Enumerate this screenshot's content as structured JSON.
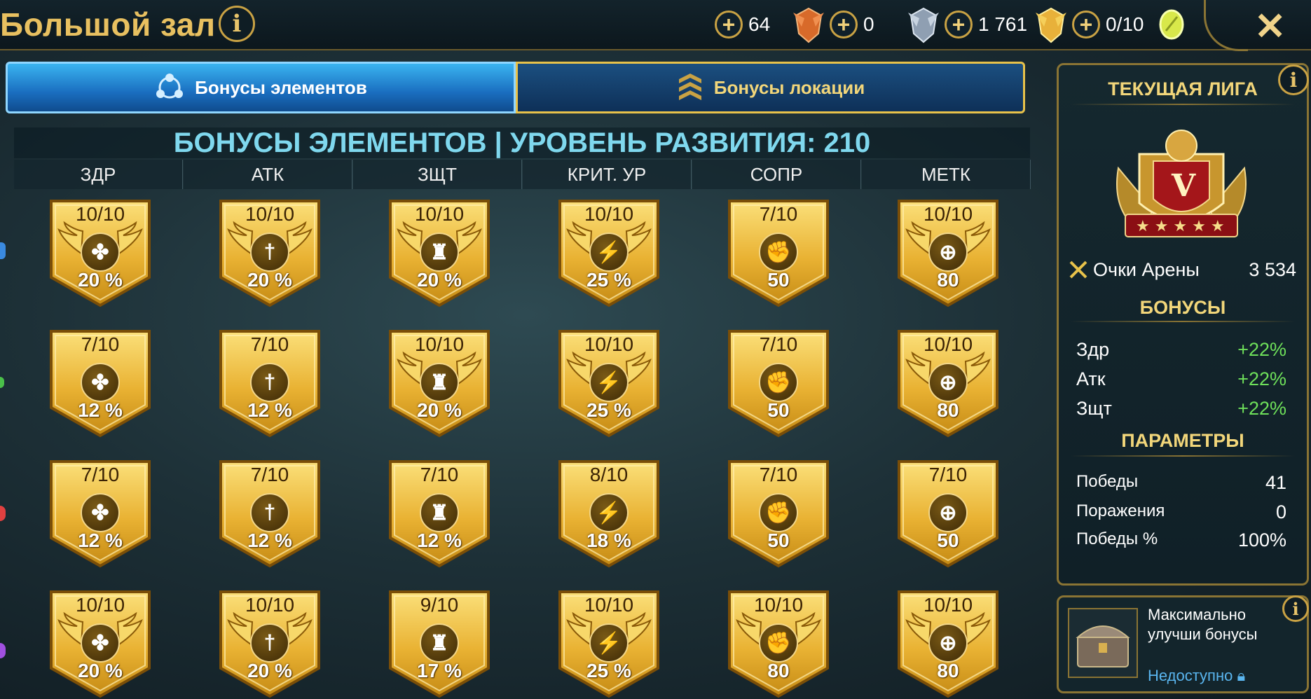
{
  "header": {
    "title": "Большой зал",
    "info_glyph": "i",
    "resources": [
      {
        "value": "64",
        "icon": "bronze-medal-icon",
        "color": "#d86a2a"
      },
      {
        "value": "0",
        "icon": "silver-medal-icon",
        "color": "#a9b7c8"
      },
      {
        "value": "1 761",
        "icon": "gold-medal-icon",
        "color": "#e8b13a"
      },
      {
        "value": "0/10",
        "icon": "arena-token-icon",
        "color": "#d8e84a"
      }
    ],
    "close_glyph": "✕"
  },
  "tabs": {
    "elements": "Бонусы элементов",
    "location": "Бонусы локации"
  },
  "grid": {
    "title": "БОНУСЫ ЭЛЕМЕНТОВ | УРОВЕНЬ РАЗВИТИЯ: 210",
    "columns": [
      "ЗДР",
      "АТК",
      "ЗЩТ",
      "КРИТ. УР",
      "СОПР",
      "МЕТК"
    ],
    "column_icons": [
      "health-icon",
      "sword-icon",
      "shield-tower-icon",
      "lightning-icon",
      "fist-icon",
      "crosshair-icon"
    ],
    "rows": [
      [
        {
          "level": "10/10",
          "value": "20 %",
          "winged": true
        },
        {
          "level": "10/10",
          "value": "20 %",
          "winged": true
        },
        {
          "level": "10/10",
          "value": "20 %",
          "winged": true
        },
        {
          "level": "10/10",
          "value": "25 %",
          "winged": true
        },
        {
          "level": "7/10",
          "value": "50",
          "winged": false
        },
        {
          "level": "10/10",
          "value": "80",
          "winged": true
        }
      ],
      [
        {
          "level": "7/10",
          "value": "12 %",
          "winged": false
        },
        {
          "level": "7/10",
          "value": "12 %",
          "winged": false
        },
        {
          "level": "10/10",
          "value": "20 %",
          "winged": true
        },
        {
          "level": "10/10",
          "value": "25 %",
          "winged": true
        },
        {
          "level": "7/10",
          "value": "50",
          "winged": false
        },
        {
          "level": "10/10",
          "value": "80",
          "winged": true
        }
      ],
      [
        {
          "level": "7/10",
          "value": "12 %",
          "winged": false
        },
        {
          "level": "7/10",
          "value": "12 %",
          "winged": false
        },
        {
          "level": "7/10",
          "value": "12 %",
          "winged": false
        },
        {
          "level": "8/10",
          "value": "18 %",
          "winged": false
        },
        {
          "level": "7/10",
          "value": "50",
          "winged": false
        },
        {
          "level": "7/10",
          "value": "50",
          "winged": false
        }
      ],
      [
        {
          "level": "10/10",
          "value": "20 %",
          "winged": true
        },
        {
          "level": "10/10",
          "value": "20 %",
          "winged": true
        },
        {
          "level": "9/10",
          "value": "17 %",
          "winged": false
        },
        {
          "level": "10/10",
          "value": "25 %",
          "winged": true
        },
        {
          "level": "10/10",
          "value": "80",
          "winged": true
        },
        {
          "level": "10/10",
          "value": "80",
          "winged": true
        }
      ]
    ]
  },
  "league": {
    "title": "ТЕКУЩАЯ ЛИГА",
    "rank_letter": "V",
    "points_label": "Очки Арены",
    "points_value": "3 534",
    "bonuses_title": "БОНУСЫ",
    "bonuses": [
      {
        "label": "Здр",
        "value": "+22%"
      },
      {
        "label": "Атк",
        "value": "+22%"
      },
      {
        "label": "Зщт",
        "value": "+22%"
      }
    ],
    "params_title": "ПАРАМЕТРЫ",
    "params": [
      {
        "label": "Победы",
        "value": "41"
      },
      {
        "label": "Поражения",
        "value": "0"
      },
      {
        "label": "Победы %",
        "value": "100%"
      }
    ]
  },
  "upgrade_card": {
    "text": "Максимально улучши бонусы",
    "status": "Недоступно"
  }
}
